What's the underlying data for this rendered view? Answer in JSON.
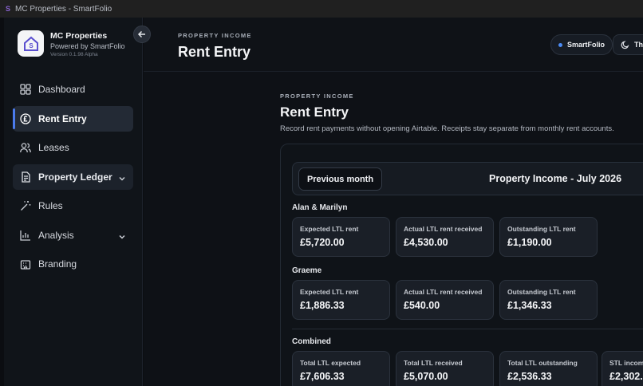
{
  "window": {
    "title": "MC Properties - SmartFolio"
  },
  "brand": {
    "name": "MC Properties",
    "powered_by": "Powered by SmartFolio",
    "version": "Version 0.1.98 Alpha"
  },
  "sidebar": {
    "items": [
      {
        "label": "Dashboard",
        "icon": "dashboard-icon"
      },
      {
        "label": "Rent Entry",
        "icon": "pound-icon",
        "active": true
      },
      {
        "label": "Leases",
        "icon": "users-icon"
      },
      {
        "label": "Property Ledger",
        "icon": "document-icon",
        "expandable": true
      },
      {
        "label": "Rules",
        "icon": "magic-wand-icon"
      },
      {
        "label": "Analysis",
        "icon": "bar-chart-icon",
        "expandable": true
      },
      {
        "label": "Branding",
        "icon": "building-icon"
      }
    ]
  },
  "header": {
    "eyebrow": "PROPERTY INCOME",
    "title": "Rent Entry",
    "smartfolio_pill": "SmartFolio",
    "theme_pill": "The"
  },
  "content": {
    "eyebrow": "PROPERTY INCOME",
    "title": "Rent Entry",
    "description": "Record rent payments without opening Airtable. Receipts stay separate from monthly rent accounts.",
    "prev_month_label": "Previous month",
    "month_title": "Property Income - July 2026",
    "groups": [
      {
        "name": "Alan & Marilyn",
        "cards": [
          {
            "label": "Expected LTL rent",
            "value": "£5,720.00"
          },
          {
            "label": "Actual LTL rent received",
            "value": "£4,530.00"
          },
          {
            "label": "Outstanding LTL rent",
            "value": "£1,190.00"
          }
        ]
      },
      {
        "name": "Graeme",
        "cards": [
          {
            "label": "Expected LTL rent",
            "value": "£1,886.33"
          },
          {
            "label": "Actual LTL rent received",
            "value": "£540.00"
          },
          {
            "label": "Outstanding LTL rent",
            "value": "£1,346.33"
          }
        ]
      },
      {
        "name": "Combined",
        "cards": [
          {
            "label": "Total LTL expected",
            "value": "£7,606.33"
          },
          {
            "label": "Total LTL received",
            "value": "£5,070.00"
          },
          {
            "label": "Total LTL outstanding",
            "value": "£2,536.33"
          },
          {
            "label": "STL income",
            "value": "£2,302."
          }
        ]
      }
    ]
  },
  "colors": {
    "accent": "#4b7bec",
    "background": "#0e1116",
    "card": "#1a1f27"
  }
}
